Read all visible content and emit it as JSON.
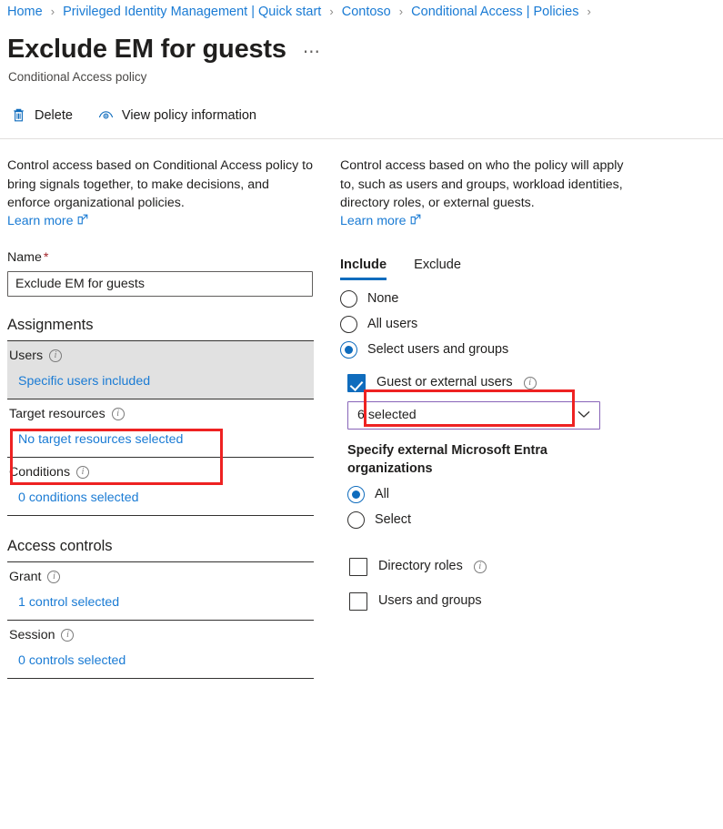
{
  "breadcrumb": {
    "separator": "›",
    "trailing_separator": "›",
    "items": [
      {
        "label": "Home"
      },
      {
        "label": "Privileged Identity Management | Quick start"
      },
      {
        "label": "Contoso"
      },
      {
        "label": "Conditional Access | Policies"
      }
    ]
  },
  "header": {
    "title": "Exclude EM for guests",
    "ellipsis": "⋯",
    "subtitle": "Conditional Access policy"
  },
  "commandbar": {
    "delete_label": "Delete",
    "view_policy_label": "View policy information"
  },
  "left": {
    "description": "Control access based on Conditional Access policy to bring signals together, to make decisions, and enforce organizational policies.",
    "learn_more": "Learn more",
    "name_label": "Name",
    "name_required_mark": "*",
    "name_value": "Exclude EM for guests",
    "assignments_heading": "Assignments",
    "rows": [
      {
        "label": "Users",
        "value": "Specific users included",
        "has_info": true
      },
      {
        "label": "Target resources",
        "value": "No target resources selected",
        "has_info": true
      },
      {
        "label": "Conditions",
        "value": "0 conditions selected",
        "has_info": true
      }
    ],
    "access_controls_heading": "Access controls",
    "control_rows": [
      {
        "label": "Grant",
        "value": "1 control selected",
        "has_info": true
      },
      {
        "label": "Session",
        "value": "0 controls selected",
        "has_info": true
      }
    ]
  },
  "right": {
    "description": "Control access based on who the policy will apply to, such as users and groups, workload identities, directory roles, or external guests.",
    "learn_more": "Learn more",
    "tabs": [
      {
        "label": "Include",
        "active": true
      },
      {
        "label": "Exclude",
        "active": false
      }
    ],
    "scope_radios": [
      {
        "label": "None",
        "checked": false
      },
      {
        "label": "All users",
        "checked": false
      },
      {
        "label": "Select users and groups",
        "checked": true
      }
    ],
    "guest_checkbox": {
      "label": "Guest or external users",
      "checked": true,
      "has_info": true
    },
    "guest_dropdown": {
      "value": "6 selected",
      "chevron": "⌄"
    },
    "external_org_heading": "Specify external Microsoft Entra organizations",
    "external_org_radios": [
      {
        "label": "All",
        "checked": true
      },
      {
        "label": "Select",
        "checked": false
      }
    ],
    "other_checkboxes": [
      {
        "label": "Directory roles",
        "checked": false,
        "has_info": true
      },
      {
        "label": "Users and groups",
        "checked": false,
        "has_info": false
      }
    ]
  },
  "icons": {
    "info": "i",
    "trash": "trash-icon",
    "eye": "eye-icon",
    "external_link": "external-link-icon"
  },
  "colors": {
    "link": "#1a7bd4",
    "accent": "#0f6cbd",
    "highlight_red": "#ee2222",
    "dropdown_purple": "#8764b8",
    "selected_row_bg": "#e1e1e1",
    "required_red": "#a4262c"
  }
}
